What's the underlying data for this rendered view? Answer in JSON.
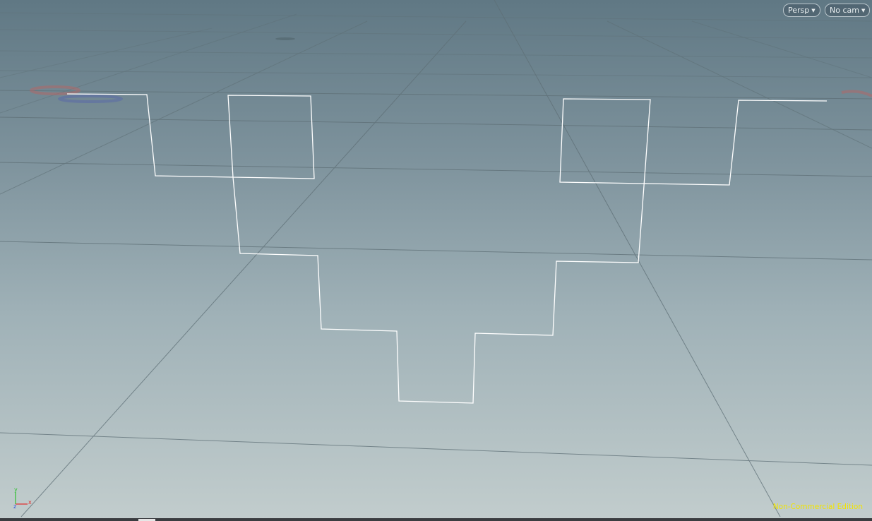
{
  "viewport": {
    "camera_menu_label": "Persp",
    "camera_select_label": "No cam",
    "edition_label": "Non-Commercial Edition",
    "axis_labels": {
      "x": "x",
      "y": "y",
      "z": "z"
    }
  },
  "colors": {
    "background_top": "#607884",
    "background_bottom": "#c2cdcd",
    "grid_line": "#5e6f76",
    "curve": "#ffffff",
    "edition_text": "#f2e400",
    "axis_x": "#e03030",
    "axis_y": "#30c030",
    "axis_z": "#3050e0"
  },
  "icons": {
    "camera_menu_caret": "chevron-down-icon",
    "axis_gizmo": "axis-gizmo-icon"
  }
}
